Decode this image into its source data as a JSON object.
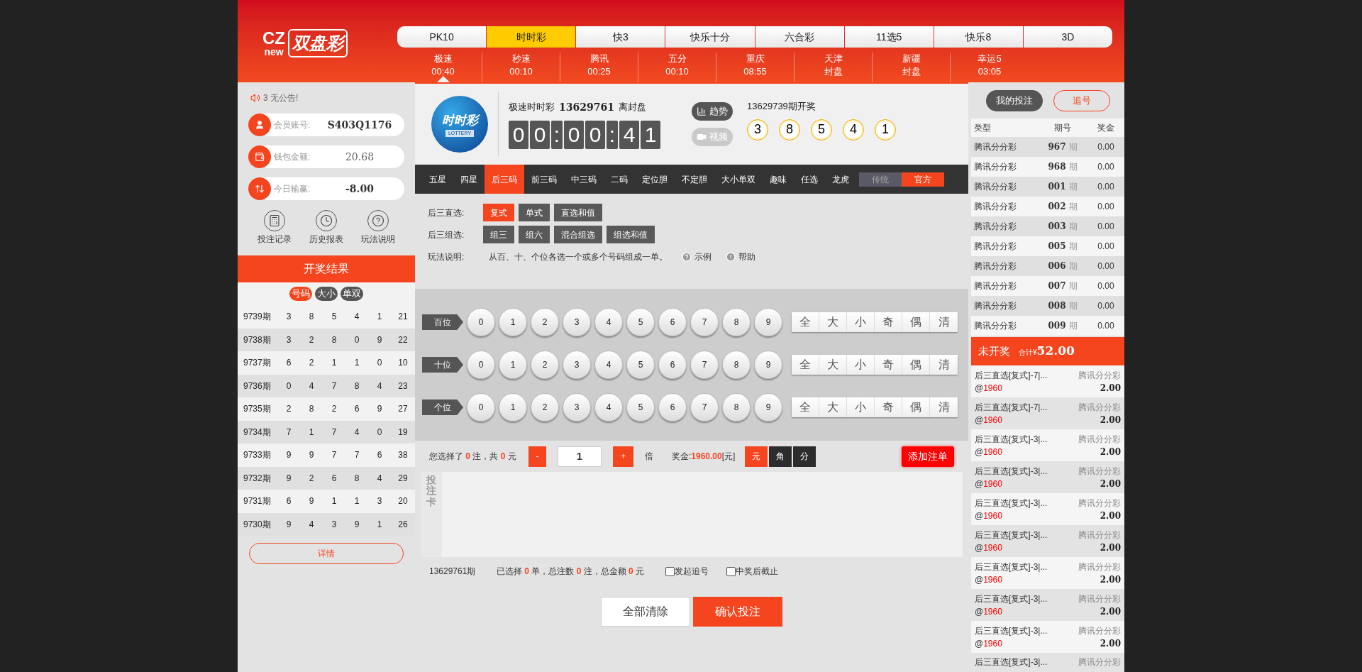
{
  "logo": {
    "top": "CZ",
    "bottom": "new",
    "name": "双盘彩"
  },
  "lottery_tabs": [
    {
      "label": "PK10",
      "selected": false
    },
    {
      "label": "时时彩",
      "selected": true
    },
    {
      "label": "快3",
      "selected": false
    },
    {
      "label": "快乐十分",
      "selected": false
    },
    {
      "label": "六合彩",
      "selected": false
    },
    {
      "label": "11选5",
      "selected": false
    },
    {
      "label": "快乐8",
      "selected": false
    },
    {
      "label": "3D",
      "selected": false
    }
  ],
  "timers": [
    {
      "name": "极速",
      "value": "00:40",
      "selected": true
    },
    {
      "name": "秒速",
      "value": "00:10",
      "selected": false
    },
    {
      "name": "腾讯",
      "value": "00:25",
      "selected": false
    },
    {
      "name": "五分",
      "value": "00:10",
      "selected": false
    },
    {
      "name": "重庆",
      "value": "08:55",
      "selected": false
    },
    {
      "name": "天津",
      "value": "封盘",
      "selected": false
    },
    {
      "name": "新疆",
      "value": "封盘",
      "selected": false
    },
    {
      "name": "幸运5",
      "value": "03:05",
      "selected": false
    }
  ],
  "sidebar": {
    "notice": "3 无公告!",
    "fields": [
      {
        "kind": "user",
        "label": "会员账号:",
        "value": "S403Q1176",
        "emphasis": true
      },
      {
        "kind": "wallet",
        "label": "钱包金额:",
        "value": "20.68",
        "emphasis": false
      },
      {
        "kind": "updown",
        "label": "今日输赢:",
        "value": "-8.00",
        "emphasis": true
      }
    ],
    "links": [
      {
        "kind": "calculator",
        "label": "投注记录"
      },
      {
        "kind": "clock",
        "label": "历史报表"
      },
      {
        "kind": "help",
        "label": "玩法说明"
      }
    ],
    "results_title": "开奖结果",
    "filters": [
      {
        "label": "号码",
        "selected": true
      },
      {
        "label": "大小",
        "selected": false
      },
      {
        "label": "单双",
        "selected": false
      }
    ],
    "results": [
      {
        "period": "9739期",
        "numbers": [
          "3",
          "8",
          "5",
          "4",
          "1"
        ],
        "sum": "21"
      },
      {
        "period": "9738期",
        "numbers": [
          "3",
          "2",
          "8",
          "0",
          "9"
        ],
        "sum": "22"
      },
      {
        "period": "9737期",
        "numbers": [
          "6",
          "2",
          "1",
          "1",
          "0"
        ],
        "sum": "10"
      },
      {
        "period": "9736期",
        "numbers": [
          "0",
          "4",
          "7",
          "8",
          "4"
        ],
        "sum": "23"
      },
      {
        "period": "9735期",
        "numbers": [
          "2",
          "8",
          "2",
          "6",
          "9"
        ],
        "sum": "27"
      },
      {
        "period": "9734期",
        "numbers": [
          "7",
          "1",
          "7",
          "4",
          "0"
        ],
        "sum": "19"
      },
      {
        "period": "9733期",
        "numbers": [
          "9",
          "9",
          "7",
          "7",
          "6"
        ],
        "sum": "38"
      },
      {
        "period": "9732期",
        "numbers": [
          "9",
          "2",
          "6",
          "8",
          "4"
        ],
        "sum": "29"
      },
      {
        "period": "9731期",
        "numbers": [
          "6",
          "9",
          "1",
          "1",
          "3"
        ],
        "sum": "20"
      },
      {
        "period": "9730期",
        "numbers": [
          "9",
          "4",
          "3",
          "9",
          "1"
        ],
        "sum": "26"
      }
    ],
    "details_button": "详情"
  },
  "game": {
    "emblem": {
      "text": "时时彩",
      "sub": "LOTTERY"
    },
    "name": "极速时时彩",
    "issue": "13629761",
    "close_label": "离封盘",
    "countdown": [
      "0",
      "0",
      ":",
      "0",
      "0",
      ":",
      "4",
      "1"
    ],
    "actions": [
      {
        "kind": "trend",
        "label": "趋势",
        "disabled": false
      },
      {
        "kind": "video",
        "label": "视频",
        "disabled": true
      }
    ],
    "last_draw_title": "13629739期开奖",
    "last_draw": [
      "3",
      "8",
      "5",
      "4",
      "1"
    ]
  },
  "play_tabs": [
    {
      "label": "五星",
      "selected": false
    },
    {
      "label": "四星",
      "selected": false
    },
    {
      "label": "后三码",
      "selected": true
    },
    {
      "label": "前三码",
      "selected": false
    },
    {
      "label": "中三码",
      "selected": false
    },
    {
      "label": "二码",
      "selected": false
    },
    {
      "label": "定位胆",
      "selected": false
    },
    {
      "label": "不定胆",
      "selected": false
    },
    {
      "label": "大小单双",
      "selected": false
    },
    {
      "label": "趣味",
      "selected": false
    },
    {
      "label": "任选",
      "selected": false
    },
    {
      "label": "龙虎",
      "selected": false
    }
  ],
  "modes": [
    {
      "label": "传统",
      "selected": false
    },
    {
      "label": "官方",
      "selected": true
    }
  ],
  "sub_plays": [
    {
      "label": "后三直选:",
      "options": [
        {
          "label": "复式",
          "selected": true
        },
        {
          "label": "单式",
          "selected": false
        },
        {
          "label": "直选和值",
          "selected": false
        }
      ]
    },
    {
      "label": "后三组选:",
      "options": [
        {
          "label": "组三",
          "selected": false
        },
        {
          "label": "组六",
          "selected": false
        },
        {
          "label": "混合组选",
          "selected": false
        },
        {
          "label": "组选和值",
          "selected": false
        }
      ]
    }
  ],
  "description": {
    "label": "玩法说明:",
    "text": "从百、十、个位各选一个或多个号码组成一单。",
    "example": "示例",
    "help": "帮助"
  },
  "positions": [
    {
      "label": "百位",
      "digits": [
        {
          "label": "0",
          "selected": false
        },
        {
          "label": "1",
          "selected": false
        },
        {
          "label": "2",
          "selected": false
        },
        {
          "label": "3",
          "selected": false
        },
        {
          "label": "4",
          "selected": false
        },
        {
          "label": "5",
          "selected": false
        },
        {
          "label": "6",
          "selected": false
        },
        {
          "label": "7",
          "selected": false
        },
        {
          "label": "8",
          "selected": false
        },
        {
          "label": "9",
          "selected": false
        }
      ],
      "quick": [
        "全",
        "大",
        "小",
        "奇",
        "偶",
        "清"
      ]
    },
    {
      "label": "十位",
      "digits": [
        {
          "label": "0",
          "selected": false
        },
        {
          "label": "1",
          "selected": false
        },
        {
          "label": "2",
          "selected": false
        },
        {
          "label": "3",
          "selected": false
        },
        {
          "label": "4",
          "selected": false
        },
        {
          "label": "5",
          "selected": false
        },
        {
          "label": "6",
          "selected": false
        },
        {
          "label": "7",
          "selected": false
        },
        {
          "label": "8",
          "selected": false
        },
        {
          "label": "9",
          "selected": false
        }
      ],
      "quick": [
        "全",
        "大",
        "小",
        "奇",
        "偶",
        "清"
      ]
    },
    {
      "label": "个位",
      "digits": [
        {
          "label": "0",
          "selected": false
        },
        {
          "label": "1",
          "selected": false
        },
        {
          "label": "2",
          "selected": false
        },
        {
          "label": "3",
          "selected": false
        },
        {
          "label": "4",
          "selected": false
        },
        {
          "label": "5",
          "selected": false
        },
        {
          "label": "6",
          "selected": false
        },
        {
          "label": "7",
          "selected": false
        },
        {
          "label": "8",
          "selected": false
        },
        {
          "label": "9",
          "selected": false
        }
      ],
      "quick": [
        "全",
        "大",
        "小",
        "奇",
        "偶",
        "清"
      ]
    }
  ],
  "bet_bar": {
    "selection": "您选择了 **0** 注，共 **0** 元",
    "minus": "-",
    "multiplier": "1",
    "plus": "+",
    "times": "倍",
    "prize": "奖金:**1960.00**[元]",
    "units": [
      {
        "label": "元",
        "selected": true
      },
      {
        "label": "角",
        "selected": false
      },
      {
        "label": "分",
        "selected": false
      }
    ],
    "add_button": "添加注单"
  },
  "ticket": {
    "side_label": "投注卡"
  },
  "summary": {
    "issue": "13629761期",
    "totals": "已选择 **0** 单，总注数 **0** 注，总金额 **0** 元",
    "options": [
      {
        "label": "发起追号",
        "checked": false
      },
      {
        "label": "中奖后截止",
        "checked": false
      }
    ]
  },
  "actions": [
    {
      "kind": "secondary",
      "label": "全部清除"
    },
    {
      "kind": "primary",
      "label": "确认投注"
    }
  ],
  "right_panel": {
    "tabs": [
      {
        "label": "我的投注",
        "selected": true
      },
      {
        "label": "追号",
        "selected": false
      }
    ],
    "columns": [
      "类型",
      "期号",
      "奖金"
    ],
    "rows": [
      {
        "type": "腾讯分分彩",
        "issue": "967",
        "suffix": "期",
        "prize": "0.00"
      },
      {
        "type": "腾讯分分彩",
        "issue": "968",
        "suffix": "期",
        "prize": "0.00"
      },
      {
        "type": "腾讯分分彩",
        "issue": "001",
        "suffix": "期",
        "prize": "0.00"
      },
      {
        "type": "腾讯分分彩",
        "issue": "002",
        "suffix": "期",
        "prize": "0.00"
      },
      {
        "type": "腾讯分分彩",
        "issue": "003",
        "suffix": "期",
        "prize": "0.00"
      },
      {
        "type": "腾讯分分彩",
        "issue": "005",
        "suffix": "期",
        "prize": "0.00"
      },
      {
        "type": "腾讯分分彩",
        "issue": "006",
        "suffix": "期",
        "prize": "0.00"
      },
      {
        "type": "腾讯分分彩",
        "issue": "007",
        "suffix": "期",
        "prize": "0.00"
      },
      {
        "type": "腾讯分分彩",
        "issue": "008",
        "suffix": "期",
        "prize": "0.00"
      },
      {
        "type": "腾讯分分彩",
        "issue": "009",
        "suffix": "期",
        "prize": "0.00"
      }
    ],
    "pending_title": "未开奖",
    "total_label": "合计¥",
    "total": "52.00",
    "bets": [
      {
        "label": "后三直选[复式]-7|...",
        "lottery": "腾讯分分彩",
        "odds": "@",
        "odds_value": "1960",
        "amount": "2.00"
      },
      {
        "label": "后三直选[复式]-7|...",
        "lottery": "腾讯分分彩",
        "odds": "@",
        "odds_value": "1960",
        "amount": "2.00"
      },
      {
        "label": "后三直选[复式]-3|...",
        "lottery": "腾讯分分彩",
        "odds": "@",
        "odds_value": "1960",
        "amount": "2.00"
      },
      {
        "label": "后三直选[复式]-3|...",
        "lottery": "腾讯分分彩",
        "odds": "@",
        "odds_value": "1960",
        "amount": "2.00"
      },
      {
        "label": "后三直选[复式]-3|...",
        "lottery": "腾讯分分彩",
        "odds": "@",
        "odds_value": "1960",
        "amount": "2.00"
      },
      {
        "label": "后三直选[复式]-3|...",
        "lottery": "腾讯分分彩",
        "odds": "@",
        "odds_value": "1960",
        "amount": "2.00"
      },
      {
        "label": "后三直选[复式]-3|...",
        "lottery": "腾讯分分彩",
        "odds": "@",
        "odds_value": "1960",
        "amount": "2.00"
      },
      {
        "label": "后三直选[复式]-3|...",
        "lottery": "腾讯分分彩",
        "odds": "@",
        "odds_value": "1960",
        "amount": "2.00"
      },
      {
        "label": "后三直选[复式]-3|...",
        "lottery": "腾讯分分彩",
        "odds": "@",
        "odds_value": "1960",
        "amount": "2.00"
      },
      {
        "label": "后三直选[复式]-3|...",
        "lottery": "腾讯分分彩"
      }
    ]
  }
}
